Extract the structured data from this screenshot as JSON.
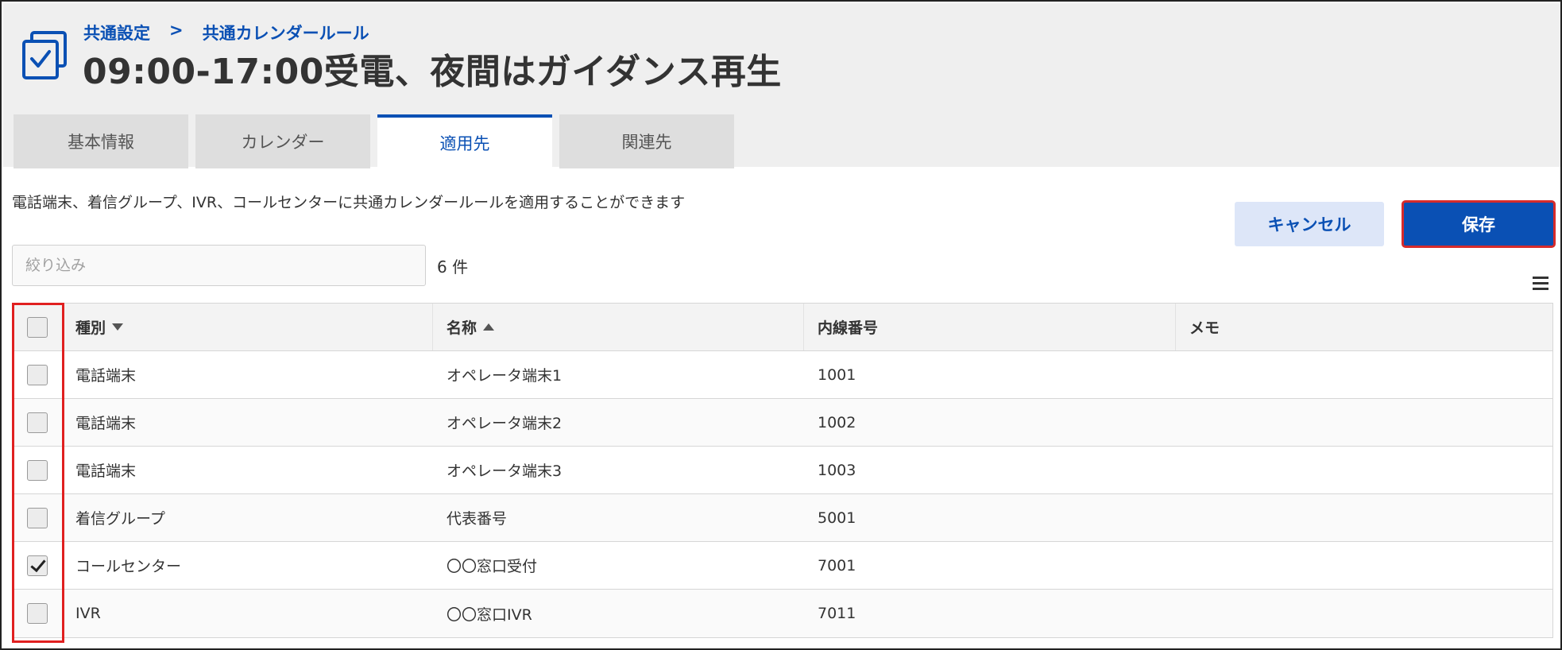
{
  "header": {
    "breadcrumb": [
      "共通設定",
      ">",
      "共通カレンダールール"
    ],
    "title": "09:00-17:00受電、夜間はガイダンス再生"
  },
  "tabs": [
    {
      "label": "基本情報",
      "active": false
    },
    {
      "label": "カレンダー",
      "active": false
    },
    {
      "label": "適用先",
      "active": true
    },
    {
      "label": "関連先",
      "active": false
    }
  ],
  "description": "電話端末、着信グループ、IVR、コールセンターに共通カレンダールールを適用することができます",
  "buttons": {
    "cancel": "キャンセル",
    "save": "保存"
  },
  "filter": {
    "placeholder": "絞り込み",
    "value": ""
  },
  "count": "6 件",
  "table": {
    "columns": [
      "種別",
      "名称",
      "内線番号",
      "メモ"
    ],
    "sort": {
      "種別": "desc",
      "名称": "asc"
    },
    "rows": [
      {
        "checked": false,
        "type": "電話端末",
        "name": "オペレータ端末1",
        "ext": "1001",
        "memo": ""
      },
      {
        "checked": false,
        "type": "電話端末",
        "name": "オペレータ端末2",
        "ext": "1002",
        "memo": ""
      },
      {
        "checked": false,
        "type": "電話端末",
        "name": "オペレータ端末3",
        "ext": "1003",
        "memo": ""
      },
      {
        "checked": false,
        "type": "着信グループ",
        "name": "代表番号",
        "ext": "5001",
        "memo": ""
      },
      {
        "checked": true,
        "type": "コールセンター",
        "name": "〇〇窓口受付",
        "ext": "7001",
        "memo": ""
      },
      {
        "checked": false,
        "type": "IVR",
        "name": "〇〇窓口IVR",
        "ext": "7011",
        "memo": ""
      }
    ]
  },
  "colors": {
    "accent": "#0a50b4",
    "header_bg": "#efefef",
    "highlight": "#e02020"
  },
  "icons": {
    "page": "checkbox-document-icon",
    "menu": "hamburger-menu-icon",
    "sort_desc": "sort-down-icon",
    "sort_asc": "sort-up-icon"
  }
}
